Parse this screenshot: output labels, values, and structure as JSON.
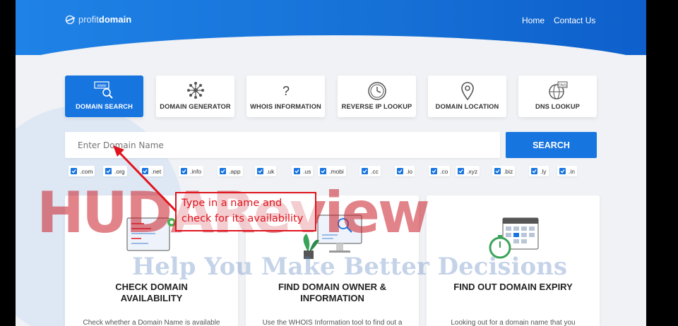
{
  "logo": {
    "part1": "profit",
    "part2": "domain"
  },
  "nav": {
    "home": "Home",
    "contact": "Contact Us"
  },
  "tools": [
    {
      "label": "DOMAIN SEARCH",
      "icon": "www-search-icon",
      "active": true
    },
    {
      "label": "DOMAIN GENERATOR",
      "icon": "network-icon"
    },
    {
      "label": "WHOIS INFORMATION",
      "icon": "question-icon"
    },
    {
      "label": "REVERSE IP LOOKUP",
      "icon": "clock-icon"
    },
    {
      "label": "DOMAIN LOCATION",
      "icon": "location-pin-icon"
    },
    {
      "label": "DNS LOOKUP",
      "icon": "dns-globe-icon"
    }
  ],
  "search": {
    "placeholder": "Enter Domain Name",
    "button": "SEARCH"
  },
  "tlds": [
    ".com",
    ".org",
    ".net",
    ".info",
    ".app",
    ".uk",
    ".us",
    ".mobi",
    ".cc",
    ".io",
    ".co",
    ".xyz",
    ".biz",
    ".ly",
    ".in"
  ],
  "cards": [
    {
      "title_line1": "CHECK DOMAIN",
      "title_line2": "AVAILABILITY",
      "desc": "Check whether a Domain Name is available"
    },
    {
      "title_line1": "FIND DOMAIN OWNER &",
      "title_line2": "INFORMATION",
      "desc": "Use the WHOIS Information tool to find out a"
    },
    {
      "title_line1": "FIND OUT DOMAIN EXPIRY",
      "title_line2": "",
      "desc": "Looking out for a domain name that you"
    }
  ],
  "annotation": {
    "line1": "Type in a name and",
    "line2": "check for its availability"
  },
  "watermark": {
    "brand": "HUDAReview",
    "tagline": "Help You Make Better Decisions"
  },
  "colors": {
    "primary": "#1775e0",
    "annotation": "#e0141e"
  }
}
